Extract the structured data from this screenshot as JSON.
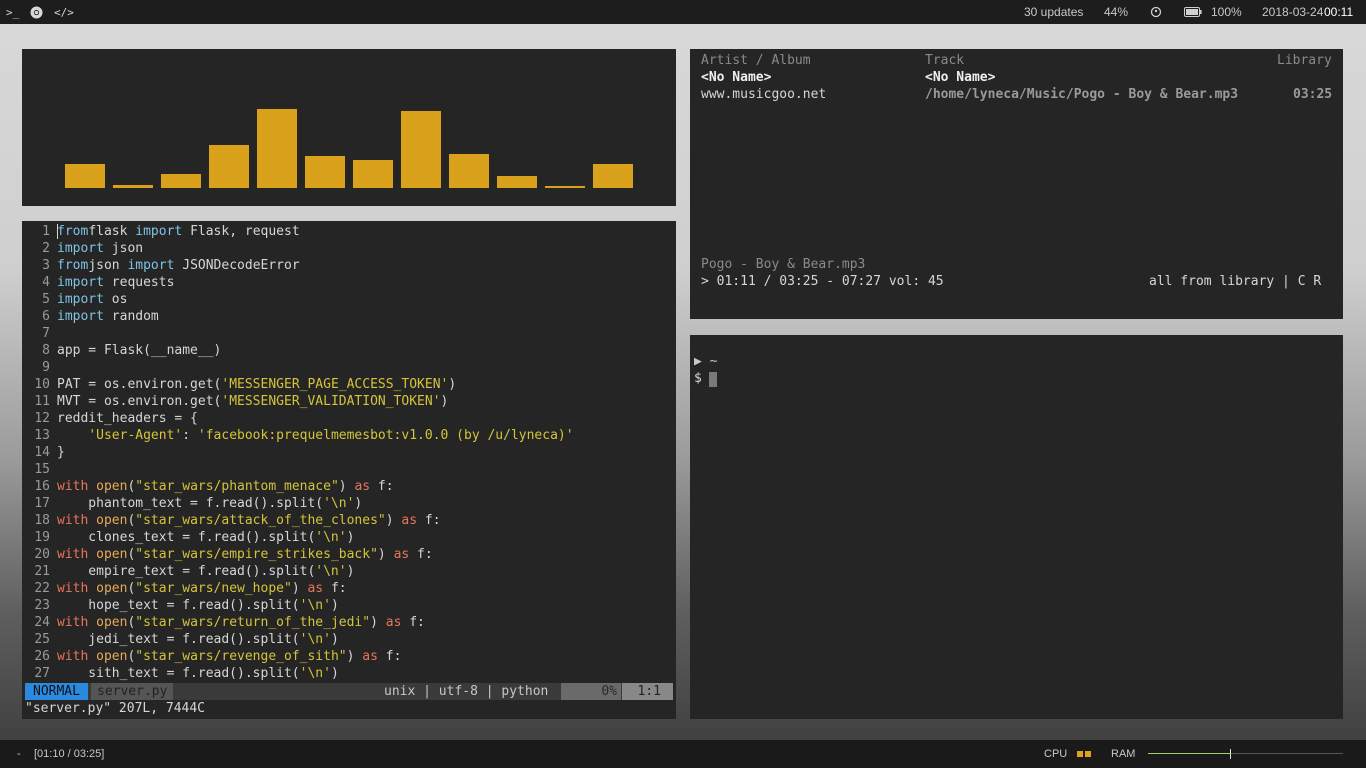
{
  "topbar": {
    "left_icons": [
      "terminal-icon",
      "chrome-icon",
      "code-icon"
    ],
    "updates": "30 updates",
    "volume": "44%",
    "battery": "100%",
    "date": "2018-03-24",
    "time": "00:11"
  },
  "visualizer": {
    "bar_color": "#d9a21a",
    "levels": [
      0.3,
      0.04,
      0.18,
      0.55,
      1.0,
      0.4,
      0.35,
      0.97,
      0.43,
      0.15,
      0.03,
      0.3
    ]
  },
  "editor": {
    "lines": [
      {
        "n": "1",
        "seg": [
          [
            "kw-b",
            "from"
          ],
          [
            "",
            "flask "
          ],
          [
            "kw-b",
            "import"
          ],
          [
            "",
            " Flask, request"
          ]
        ]
      },
      {
        "n": "2",
        "seg": [
          [
            "kw-b",
            "import"
          ],
          [
            "",
            " json"
          ]
        ]
      },
      {
        "n": "3",
        "seg": [
          [
            "kw-b",
            "from"
          ],
          [
            "",
            "json "
          ],
          [
            "kw-b",
            "import"
          ],
          [
            "",
            " JSONDecodeError"
          ]
        ]
      },
      {
        "n": "4",
        "seg": [
          [
            "kw-b",
            "import"
          ],
          [
            "",
            " requests"
          ]
        ]
      },
      {
        "n": "5",
        "seg": [
          [
            "kw-b",
            "import"
          ],
          [
            "",
            " os"
          ]
        ]
      },
      {
        "n": "6",
        "seg": [
          [
            "kw-b",
            "import"
          ],
          [
            "",
            " random"
          ]
        ]
      },
      {
        "n": "7",
        "seg": []
      },
      {
        "n": "8",
        "seg": [
          [
            "",
            "app = Flask(__name__)"
          ]
        ]
      },
      {
        "n": "9",
        "seg": []
      },
      {
        "n": "10",
        "seg": [
          [
            "",
            "PAT = os.environ.get("
          ],
          [
            "str",
            "'MESSENGER_PAGE_ACCESS_TOKEN'"
          ],
          [
            "",
            ")"
          ]
        ]
      },
      {
        "n": "11",
        "seg": [
          [
            "",
            "MVT = os.environ.get("
          ],
          [
            "str",
            "'MESSENGER_VALIDATION_TOKEN'"
          ],
          [
            "",
            ")"
          ]
        ]
      },
      {
        "n": "12",
        "seg": [
          [
            "",
            "reddit_headers = {"
          ]
        ]
      },
      {
        "n": "13",
        "seg": [
          [
            "",
            "    "
          ],
          [
            "str",
            "'User-Agent'"
          ],
          [
            "",
            ": "
          ],
          [
            "str",
            "'facebook:prequelmemesbot:v1.0.0 (by /u/lyneca)'"
          ]
        ]
      },
      {
        "n": "14",
        "seg": [
          [
            "",
            "}"
          ]
        ]
      },
      {
        "n": "15",
        "seg": []
      },
      {
        "n": "16",
        "seg": [
          [
            "kw-r",
            "with"
          ],
          [
            "",
            " "
          ],
          [
            "fn",
            "open"
          ],
          [
            "",
            "("
          ],
          [
            "str",
            "\"star_wars/phantom_menace\""
          ],
          [
            "",
            ") "
          ],
          [
            "kw-r",
            "as"
          ],
          [
            "",
            " f:"
          ]
        ]
      },
      {
        "n": "17",
        "seg": [
          [
            "",
            "    phantom_text = f.read().split("
          ],
          [
            "str",
            "'\\n'"
          ],
          [
            "",
            ")"
          ]
        ]
      },
      {
        "n": "18",
        "seg": [
          [
            "kw-r",
            "with"
          ],
          [
            "",
            " "
          ],
          [
            "fn",
            "open"
          ],
          [
            "",
            "("
          ],
          [
            "str",
            "\"star_wars/attack_of_the_clones\""
          ],
          [
            "",
            ") "
          ],
          [
            "kw-r",
            "as"
          ],
          [
            "",
            " f:"
          ]
        ]
      },
      {
        "n": "19",
        "seg": [
          [
            "",
            "    clones_text = f.read().split("
          ],
          [
            "str",
            "'\\n'"
          ],
          [
            "",
            ")"
          ]
        ]
      },
      {
        "n": "20",
        "seg": [
          [
            "kw-r",
            "with"
          ],
          [
            "",
            " "
          ],
          [
            "fn",
            "open"
          ],
          [
            "",
            "("
          ],
          [
            "str",
            "\"star_wars/empire_strikes_back\""
          ],
          [
            "",
            ") "
          ],
          [
            "kw-r",
            "as"
          ],
          [
            "",
            " f:"
          ]
        ]
      },
      {
        "n": "21",
        "seg": [
          [
            "",
            "    empire_text = f.read().split("
          ],
          [
            "str",
            "'\\n'"
          ],
          [
            "",
            ")"
          ]
        ]
      },
      {
        "n": "22",
        "seg": [
          [
            "kw-r",
            "with"
          ],
          [
            "",
            " "
          ],
          [
            "fn",
            "open"
          ],
          [
            "",
            "("
          ],
          [
            "str",
            "\"star_wars/new_hope\""
          ],
          [
            "",
            ") "
          ],
          [
            "kw-r",
            "as"
          ],
          [
            "",
            " f:"
          ]
        ]
      },
      {
        "n": "23",
        "seg": [
          [
            "",
            "    hope_text = f.read().split("
          ],
          [
            "str",
            "'\\n'"
          ],
          [
            "",
            ")"
          ]
        ]
      },
      {
        "n": "24",
        "seg": [
          [
            "kw-r",
            "with"
          ],
          [
            "",
            " "
          ],
          [
            "fn",
            "open"
          ],
          [
            "",
            "("
          ],
          [
            "str",
            "\"star_wars/return_of_the_jedi\""
          ],
          [
            "",
            ") "
          ],
          [
            "kw-r",
            "as"
          ],
          [
            "",
            " f:"
          ]
        ]
      },
      {
        "n": "25",
        "seg": [
          [
            "",
            "    jedi_text = f.read().split("
          ],
          [
            "str",
            "'\\n'"
          ],
          [
            "",
            ")"
          ]
        ]
      },
      {
        "n": "26",
        "seg": [
          [
            "kw-r",
            "with"
          ],
          [
            "",
            " "
          ],
          [
            "fn",
            "open"
          ],
          [
            "",
            "("
          ],
          [
            "str",
            "\"star_wars/revenge_of_sith\""
          ],
          [
            "",
            ") "
          ],
          [
            "kw-r",
            "as"
          ],
          [
            "",
            " f:"
          ]
        ]
      },
      {
        "n": "27",
        "seg": [
          [
            "",
            "    sith_text = f.read().split("
          ],
          [
            "str",
            "'\\n'"
          ],
          [
            "",
            ")"
          ]
        ]
      }
    ],
    "status": {
      "mode": "NORMAL",
      "filename": "server.py",
      "fileinfo": "unix | utf-8 | python",
      "percent": "0%",
      "position": "1:1"
    },
    "cmdline": "\"server.py\" 207L, 7444C"
  },
  "music": {
    "col1_header": "Artist / Album",
    "col2_header": "Track",
    "col3_header": "Library",
    "artist": "<No Name>",
    "track_title": "<No Name>",
    "album": "www.musicgoo.net",
    "path": "/home/lyneca/Music/Pogo - Boy & Bear.mp3",
    "duration": "03:25",
    "now_playing": "Pogo - Boy & Bear.mp3",
    "progress": "> 01:11 / 03:25 - 07:27 vol: 45",
    "mode": "all from library | C R"
  },
  "terminal": {
    "prompt_dir": "▶ ~",
    "prompt": "$"
  },
  "bottombar": {
    "dash": "-",
    "track_time": "[01:10 / 03:25]",
    "cpu_label": "CPU",
    "ram_label": "RAM",
    "ram_level": 0.42
  }
}
